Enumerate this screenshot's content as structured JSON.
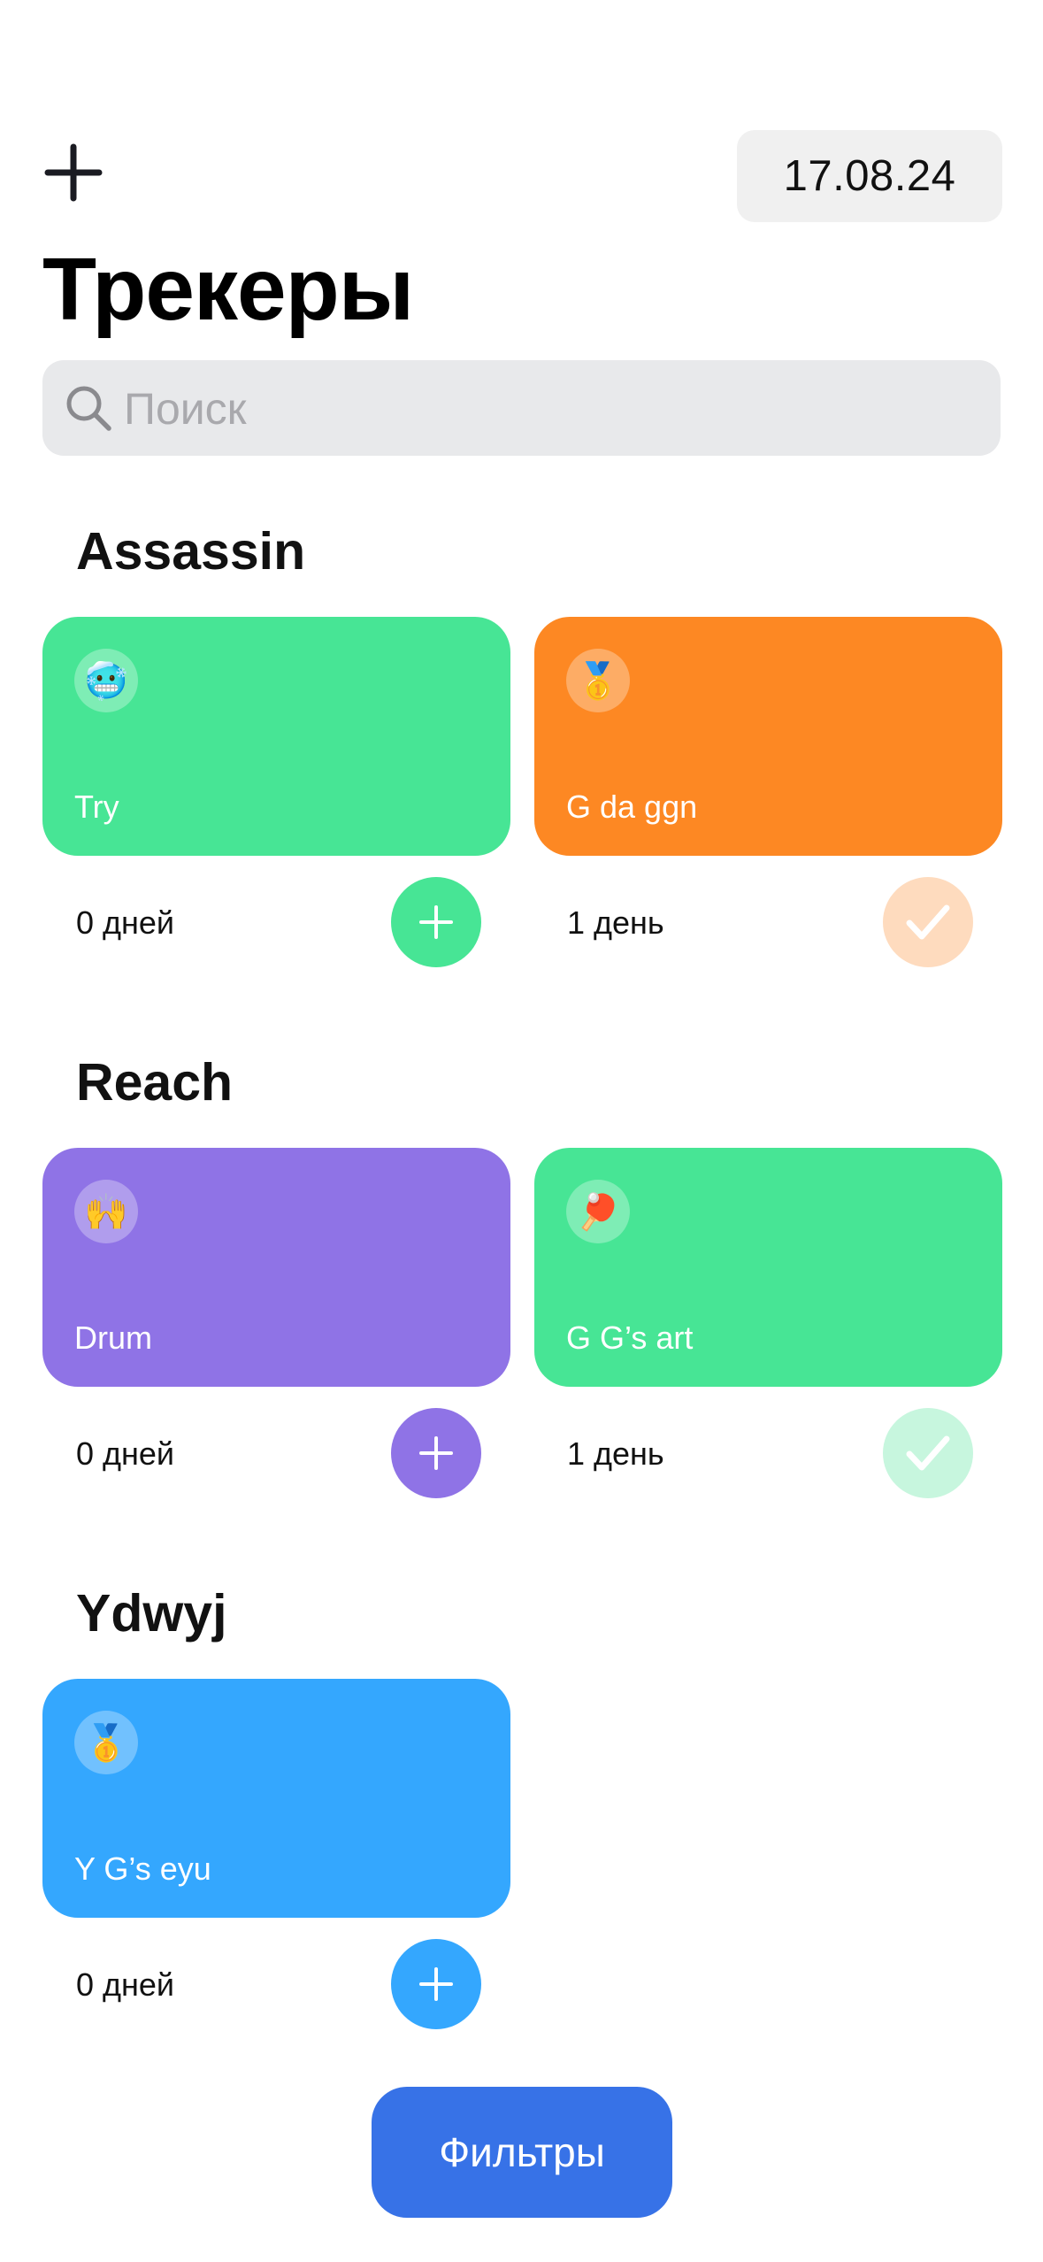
{
  "header": {
    "date": "17.08.24",
    "title": "Трекеры"
  },
  "search": {
    "placeholder": "Поиск",
    "value": ""
  },
  "categories": [
    {
      "title": "Assassin",
      "trackers": [
        {
          "emoji": "🥶",
          "name": "Try",
          "days": "0 дней",
          "color": "#47e595",
          "done": false
        },
        {
          "emoji": "🥇",
          "name": "G da ggn",
          "days": "1 день",
          "color": "#fd8823",
          "done": true
        }
      ]
    },
    {
      "title": "Reach",
      "trackers": [
        {
          "emoji": "🙌",
          "name": "Drum",
          "days": "0 дней",
          "color": "#8f73e6",
          "done": false
        },
        {
          "emoji": "🏓",
          "name": "G G’s art",
          "days": "1 день",
          "color": "#47e595",
          "done": true
        }
      ]
    },
    {
      "title": "Ydwyj",
      "trackers": [
        {
          "emoji": "🥇",
          "name": "Y G’s eyu",
          "days": "0 дней",
          "color": "#34a7fe",
          "done": false
        }
      ]
    }
  ],
  "footer": {
    "filters_label": "Фильтры"
  },
  "icons": {
    "add": "plus-icon",
    "search": "search-icon",
    "increment": "plus-icon",
    "done": "checkmark-icon"
  }
}
